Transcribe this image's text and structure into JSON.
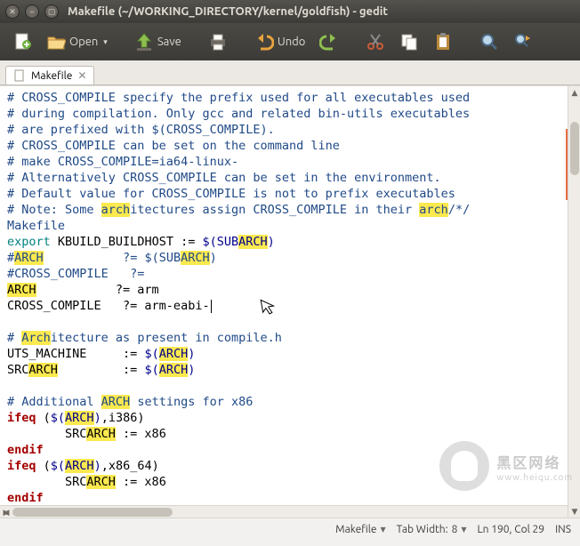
{
  "window": {
    "title": "Makefile (~/WORKING_DIRECTORY/kernel/goldfish) - gedit"
  },
  "toolbar": {
    "open": "Open",
    "save": "Save",
    "undo": "Undo"
  },
  "tab": {
    "filename": "Makefile",
    "close": "✕"
  },
  "code": {
    "l1a": "# CROSS_COMPILE specify the prefix used for all executables used",
    "l2a": "# during compilation. Only gcc and related bin-utils executables",
    "l3a": "# are prefixed with $(CROSS_COMPILE).",
    "l4a": "# CROSS_COMPILE can be set on the command line",
    "l5a": "# make CROSS_COMPILE=ia64-linux-",
    "l6a": "# Alternatively CROSS_COMPILE can be set in the environment.",
    "l7a": "# Default value for CROSS_COMPILE is not to prefix executables",
    "l8a": "# Note: Some ",
    "l8b": "arch",
    "l8c": "itectures assign CROSS_COMPILE in their ",
    "l8d": "arch",
    "l8e": "/*/",
    "l8f": "Makefile",
    "l9a": "export",
    "l9b": " KBUILD_BUILDHOST := ",
    "l9c": "$(",
    "l9d": "SUB",
    "l9e": "ARCH",
    "l9f": ")",
    "l10a": "#",
    "l10b": "ARCH",
    "l10c": "           ?= $(SUB",
    "l10d": "ARCH",
    "l10e": ")",
    "l11a": "#CROSS_COMPILE   ?=",
    "l12a": "ARCH",
    "l12b": "           ?= arm",
    "l13a": "CROSS_COMPILE   ?= arm-eabi-",
    "l15a": "# ",
    "l15b": "Arch",
    "l15c": "itecture as present in compile.h",
    "l16a": "UTS_MACHINE     := ",
    "l16b": "$(",
    "l16c": "ARCH",
    "l16d": ")",
    "l17a": "SRC",
    "l17b": "ARCH",
    "l17c": "         := ",
    "l17d": "$(",
    "l17e": "ARCH",
    "l17f": ")",
    "l19a": "# Additional ",
    "l19b": "ARCH",
    "l19c": " settings for x86",
    "l20a": "ifeq",
    "l20b": " (",
    "l20c": "$(",
    "l20d": "ARCH",
    "l20e": ")",
    "l20f": ",i386)",
    "l21a": "        SRC",
    "l21b": "ARCH",
    "l21c": " := x86",
    "l22a": "endif",
    "l23a": "ifeq",
    "l23b": " (",
    "l23c": "$(",
    "l23d": "ARCH",
    "l23e": ")",
    "l23f": ",x86_64)",
    "l24a": "        SRC",
    "l24b": "ARCH",
    "l24c": " := x86",
    "l25a": "endif"
  },
  "status": {
    "lang": "Makefile",
    "tabwidth_label": "Tab Width:",
    "tabwidth_value": "8",
    "position": "Ln 190, Col 29",
    "ins": "INS"
  },
  "watermark": {
    "cn": "黑区网络",
    "url": "www.heiqu.com"
  }
}
